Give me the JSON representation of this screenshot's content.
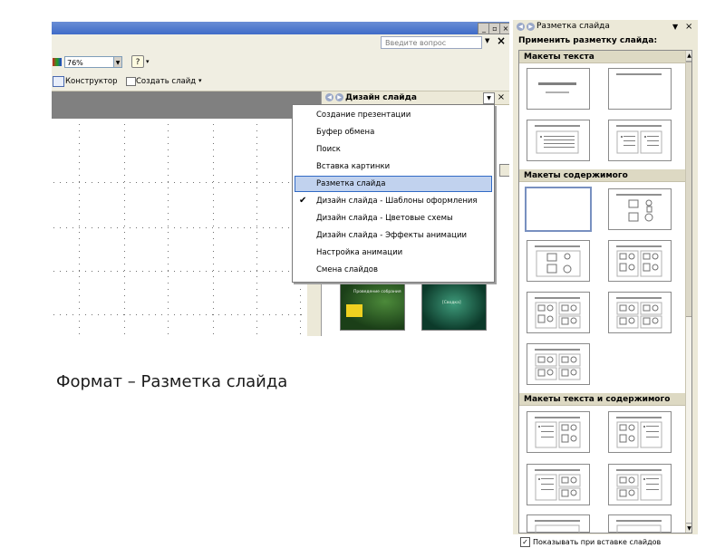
{
  "toolbar": {
    "help_placeholder": "Введите вопрос",
    "zoom": "76%",
    "designer_label": "Конструктор",
    "new_slide_label": "Создать слайд"
  },
  "design_pane": {
    "title": "Дизайн слайда",
    "thumb1_text": "Проведение собрания",
    "thumb2_text": "[Сводка]"
  },
  "menu": {
    "items": [
      {
        "label": "Создание презентации",
        "checked": false,
        "selected": false
      },
      {
        "label": "Буфер обмена",
        "checked": false,
        "selected": false
      },
      {
        "label": "Поиск",
        "checked": false,
        "selected": false
      },
      {
        "label": "Вставка картинки",
        "checked": false,
        "selected": false
      },
      {
        "label": "Разметка слайда",
        "checked": false,
        "selected": true
      },
      {
        "label": "Дизайн слайда - Шаблоны оформления",
        "checked": true,
        "selected": false
      },
      {
        "label": "Дизайн слайда - Цветовые схемы",
        "checked": false,
        "selected": false
      },
      {
        "label": "Дизайн слайда - Эффекты анимации",
        "checked": false,
        "selected": false
      },
      {
        "label": "Настройка анимации",
        "checked": false,
        "selected": false
      },
      {
        "label": "Смена слайдов",
        "checked": false,
        "selected": false
      }
    ]
  },
  "caption": "Формат – Разметка слайда",
  "layout_pane": {
    "title": "Разметка слайда",
    "apply_label": "Применить разметку слайда:",
    "sections": [
      "Макеты текста",
      "Макеты содержимого",
      "Макеты текста и содержимого"
    ],
    "footer_label": "Показывать при вставке слайдов",
    "footer_checked": true
  }
}
